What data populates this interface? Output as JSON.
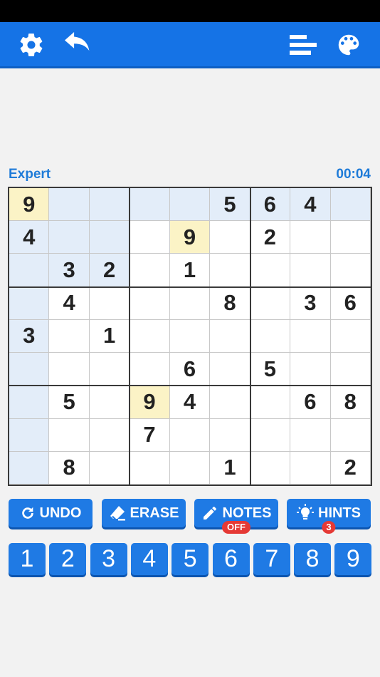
{
  "toolbar": {
    "icons": [
      "gear-icon",
      "undo-arrow-icon",
      "stats-bars-icon",
      "palette-icon"
    ]
  },
  "game": {
    "difficulty": "Expert",
    "timer": "00:04"
  },
  "board": {
    "rows": [
      [
        "9",
        "",
        "",
        "",
        "",
        "5",
        "6",
        "4",
        ""
      ],
      [
        "4",
        "",
        "",
        "",
        "9",
        "",
        "2",
        "",
        ""
      ],
      [
        "",
        "3",
        "2",
        "",
        "1",
        "",
        "",
        "",
        ""
      ],
      [
        "",
        "4",
        "",
        "",
        "",
        "8",
        "",
        "3",
        "6"
      ],
      [
        "3",
        "",
        "1",
        "",
        "",
        "",
        "",
        "",
        ""
      ],
      [
        "",
        "",
        "",
        "",
        "6",
        "",
        "5",
        "",
        ""
      ],
      [
        "",
        "5",
        "",
        "9",
        "4",
        "",
        "",
        "6",
        "8"
      ],
      [
        "",
        "",
        "",
        "7",
        "",
        "",
        "",
        "",
        ""
      ],
      [
        "",
        "8",
        "",
        "",
        "",
        "1",
        "",
        "",
        "2"
      ]
    ],
    "selected": [
      0,
      0
    ],
    "highlight_color": "#e3edf9",
    "same_number_color": "#fbf3c6"
  },
  "actions": {
    "undo": "UNDO",
    "erase": "ERASE",
    "notes": "NOTES",
    "notes_state": "OFF",
    "hints": "HINTS",
    "hints_count": "3"
  },
  "numpad": [
    "1",
    "2",
    "3",
    "4",
    "5",
    "6",
    "7",
    "8",
    "9"
  ],
  "colors": {
    "accent": "#1573e6",
    "badge": "#e53935",
    "text_accent": "#1e7bd8"
  }
}
